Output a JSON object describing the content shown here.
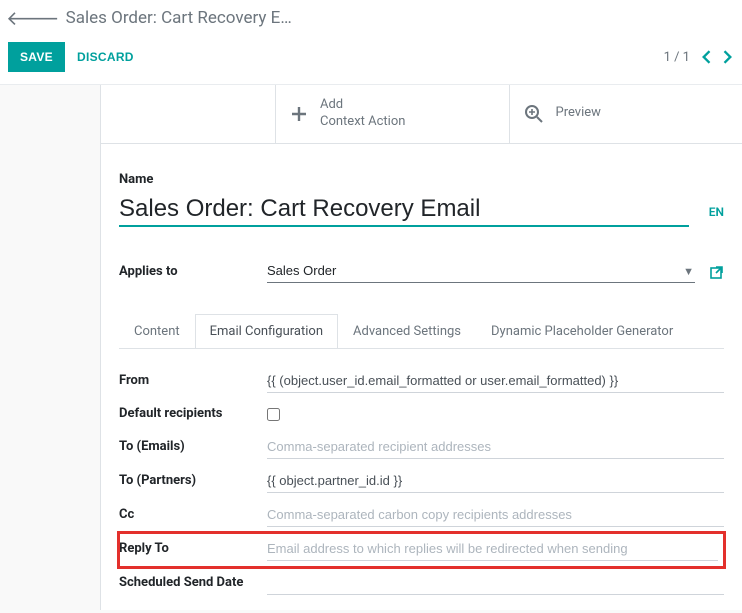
{
  "breadcrumb": {
    "title": "Sales Order: Cart Recovery E…"
  },
  "toolbar": {
    "save_label": "SAVE",
    "discard_label": "DISCARD",
    "pager": "1 / 1"
  },
  "actions": {
    "add_context_line1": "Add",
    "add_context_line2": "Context Action",
    "preview": "Preview"
  },
  "form": {
    "name_label": "Name",
    "name_value": "Sales Order: Cart Recovery Email",
    "lang_badge": "EN",
    "applies_label": "Applies to",
    "applies_value": "Sales Order"
  },
  "tabs": [
    {
      "label": "Content"
    },
    {
      "label": "Email Configuration"
    },
    {
      "label": "Advanced Settings"
    },
    {
      "label": "Dynamic Placeholder Generator"
    }
  ],
  "config": {
    "from_label": "From",
    "from_value": "{{ (object.user_id.email_formatted or user.email_formatted) }}",
    "default_recipients_label": "Default recipients",
    "default_recipients_checked": false,
    "to_emails_label": "To (Emails)",
    "to_emails_placeholder": "Comma-separated recipient addresses",
    "to_emails_value": "",
    "to_partners_label": "To (Partners)",
    "to_partners_value": "{{ object.partner_id.id }}",
    "cc_label": "Cc",
    "cc_placeholder": "Comma-separated carbon copy recipients addresses",
    "cc_value": "",
    "reply_to_label": "Reply To",
    "reply_to_placeholder": "Email address to which replies will be redirected when sending",
    "reply_to_value": "",
    "scheduled_label": "Scheduled Send Date",
    "scheduled_value": ""
  }
}
